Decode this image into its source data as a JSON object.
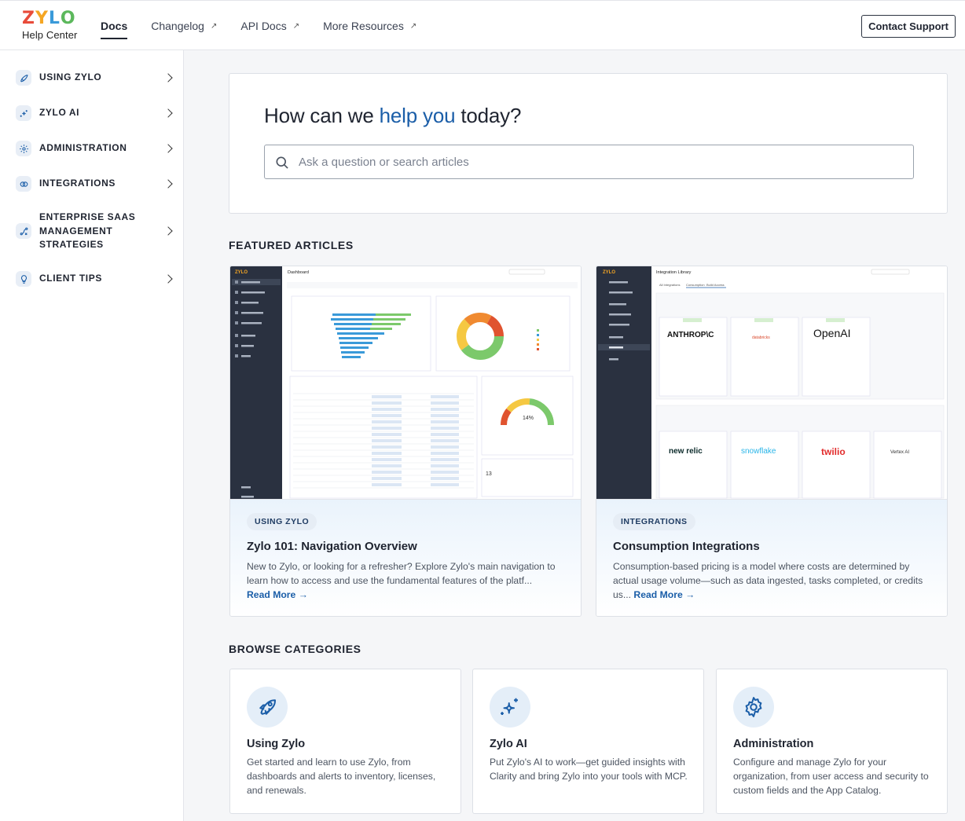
{
  "header": {
    "logo_letters": [
      "Z",
      "Y",
      "L",
      "O"
    ],
    "logo_colors": [
      "#e84b3a",
      "#f5a623",
      "#3a9ad9",
      "#5cb85c"
    ],
    "logo_sub": "Help Center",
    "nav": [
      {
        "label": "Docs",
        "active": true,
        "external": false
      },
      {
        "label": "Changelog",
        "external": true
      },
      {
        "label": "API Docs",
        "external": true
      },
      {
        "label": "More Resources",
        "external": true
      }
    ],
    "external_glyph": "↗",
    "contact_label": "Contact Support"
  },
  "sidebar": {
    "items": [
      {
        "label": "USING ZYLO",
        "icon": "rocket-icon"
      },
      {
        "label": "ZYLO AI",
        "icon": "sparkle-icon"
      },
      {
        "label": "ADMINISTRATION",
        "icon": "gear-icon"
      },
      {
        "label": "INTEGRATIONS",
        "icon": "link-icon"
      },
      {
        "label": "ENTERPRISE SAAS MANAGEMENT STRATEGIES",
        "icon": "strategy-icon"
      },
      {
        "label": "CLIENT TIPS",
        "icon": "lightbulb-icon"
      }
    ]
  },
  "hero": {
    "title_before": "How can we ",
    "title_accent": "help you",
    "title_after": " today?",
    "search_placeholder": "Ask a question or search articles"
  },
  "featured": {
    "heading": "FEATURED ARTICLES",
    "articles": [
      {
        "tag": "USING ZYLO",
        "title": "Zylo 101: Navigation Overview",
        "desc": "New to Zylo, or looking for a refresher? Explore Zylo's main navigation to learn how to access and use the fundamental features of the platf...",
        "read_more": "Read More →"
      },
      {
        "tag": "INTEGRATIONS",
        "title": "Consumption Integrations",
        "desc": "Consumption-based pricing is a model where costs are determined by actual usage volume—such as data ingested, tasks completed, or credits us...",
        "read_more": "Read More →"
      }
    ],
    "shot1": {
      "page_title": "Dashboard",
      "percent": "14%",
      "count": "13",
      "nav": [
        "Dashboards",
        "Reports & Insights",
        "Vendor Data",
        "Application Data",
        "Financial Data",
        "Automate",
        "Connect",
        "Clarity"
      ]
    },
    "shot2": {
      "page_title": "Integration Library",
      "tabs": [
        "All Integrations",
        "Consumption",
        "Build Access"
      ],
      "logos_top": [
        "ANTHROP\\C",
        "databricks",
        "OpenAI"
      ],
      "logos_bottom": [
        "new relic",
        "snowflake",
        "twilio",
        "Vertex AI"
      ],
      "nav": [
        "Dashboards",
        "Reports & Insights",
        "Vendor Data",
        "Application Data",
        "Financial Data",
        "Automate",
        "Connect",
        "Clarity"
      ]
    }
  },
  "browse": {
    "heading": "BROWSE CATEGORIES",
    "cards": [
      {
        "title": "Using Zylo",
        "desc": "Get started and learn to use Zylo, from dashboards and alerts to inventory, licenses, and renewals.",
        "icon": "rocket-icon"
      },
      {
        "title": "Zylo AI",
        "desc": "Put Zylo's AI to work—get guided insights with Clarity and bring Zylo into your tools with MCP.",
        "icon": "sparkle-icon"
      },
      {
        "title": "Administration",
        "desc": "Configure and manage Zylo for your organization, from user access and security to custom fields and the App Catalog.",
        "icon": "gear-icon"
      }
    ]
  }
}
